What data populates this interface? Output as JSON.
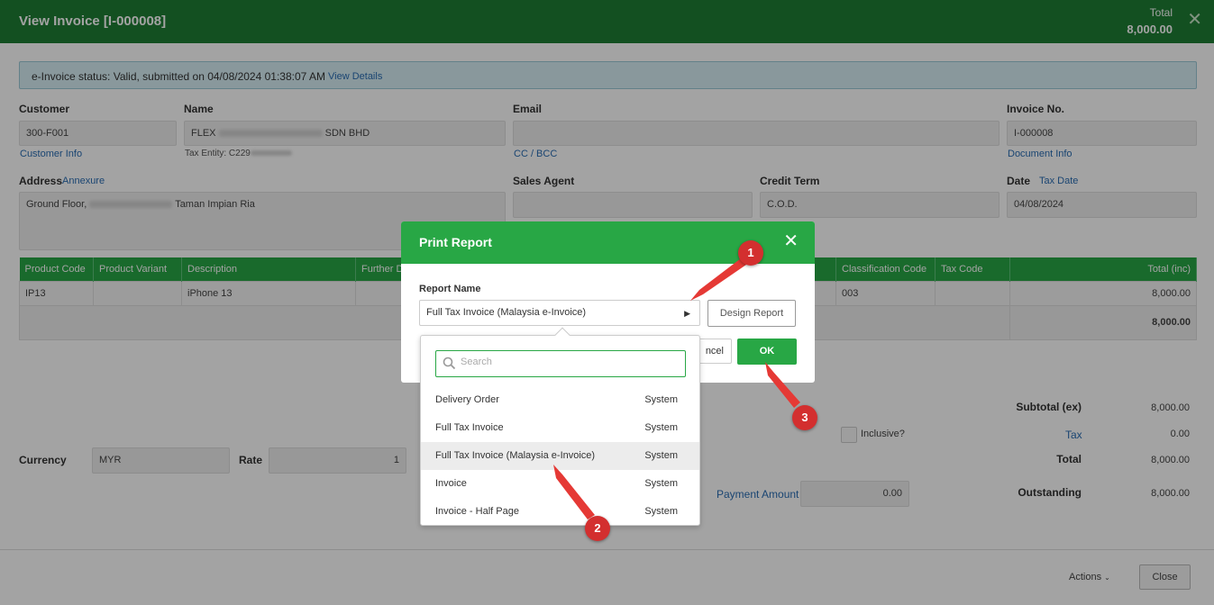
{
  "header": {
    "title": "View Invoice [I-000008]",
    "total_label": "Total",
    "total_value": "8,000.00"
  },
  "status": {
    "text": "e-Invoice status: Valid, submitted on 04/08/2024 01:38:07 AM",
    "link": "View Details"
  },
  "customer": {
    "label": "Customer",
    "value": "300-F001",
    "link": "Customer Info"
  },
  "name": {
    "label": "Name",
    "prefix": "FLEX",
    "suffix": "SDN BHD",
    "tax_entity": "Tax Entity: C229"
  },
  "email": {
    "label": "Email",
    "value": "",
    "link": "CC / BCC"
  },
  "invoice_no": {
    "label": "Invoice No.",
    "value": "I-000008",
    "link": "Document Info"
  },
  "address": {
    "label": "Address",
    "link": "Annexure",
    "prefix": "Ground Floor,",
    "suffix": "Taman Impian Ria"
  },
  "sales_agent": {
    "label": "Sales Agent",
    "value": ""
  },
  "credit_term": {
    "label": "Credit Term",
    "value": "C.O.D."
  },
  "date": {
    "label": "Date",
    "link": "Tax Date",
    "value": "04/08/2024"
  },
  "table": {
    "headers": [
      "Product Code",
      "Product Variant",
      "Description",
      "Further D",
      "Classification Code",
      "Tax Code",
      "Total (inc)"
    ],
    "row": {
      "product_code": "IP13",
      "variant": "",
      "description": "iPhone 13",
      "classification": "003",
      "tax_code": "",
      "total": "8,000.00"
    },
    "grand_total": "8,000.00"
  },
  "summary": {
    "subtotal_label": "Subtotal (ex)",
    "subtotal": "8,000.00",
    "inclusive_label": "Inclusive?",
    "tax_label": "Tax",
    "tax": "0.00",
    "total_label": "Total",
    "total": "8,000.00",
    "payment_label": "Payment Amount",
    "payment": "0.00",
    "outstanding_label": "Outstanding",
    "outstanding": "8,000.00"
  },
  "currency": {
    "label": "Currency",
    "value": "MYR",
    "rate_label": "Rate",
    "rate": "1"
  },
  "footer": {
    "actions": "Actions",
    "close": "Close"
  },
  "modal": {
    "title": "Print Report",
    "report_name_label": "Report Name",
    "selected": "Full Tax Invoice (Malaysia e-Invoice)",
    "design_button": "Design Report",
    "cancel_button": "ncel",
    "ok_button": "OK"
  },
  "dropdown": {
    "search_placeholder": "Search",
    "options": [
      {
        "name": "Delivery Order",
        "source": "System"
      },
      {
        "name": "Full Tax Invoice",
        "source": "System"
      },
      {
        "name": "Full Tax Invoice (Malaysia e-Invoice)",
        "source": "System"
      },
      {
        "name": "Invoice",
        "source": "System"
      },
      {
        "name": "Invoice - Half Page",
        "source": "System"
      }
    ]
  },
  "markers": [
    "1",
    "2",
    "3"
  ],
  "colors": {
    "header_green": "#1e7e34",
    "accent_green": "#28a745",
    "link_blue": "#2a6db3",
    "marker_red": "#d32f2f"
  }
}
